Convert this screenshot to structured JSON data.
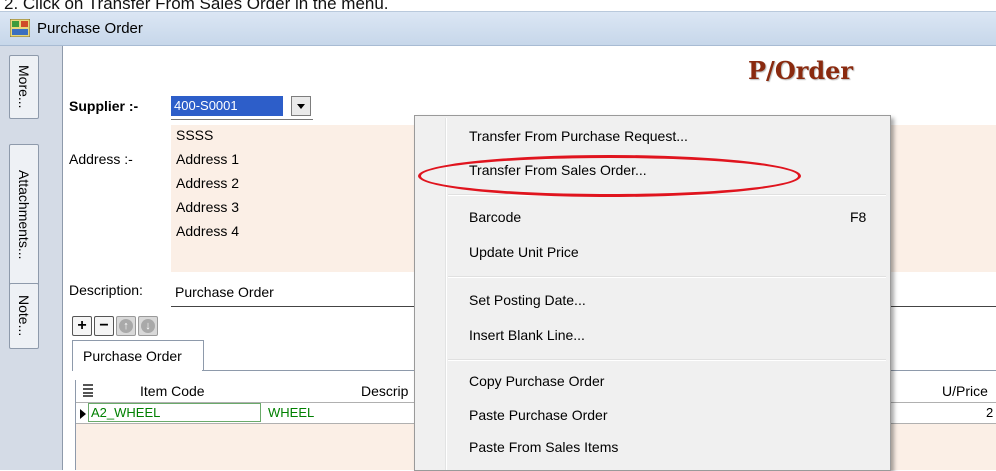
{
  "instruction": "2.   Click on Transfer From Sales Order in the menu.",
  "window": {
    "title": "Purchase Order"
  },
  "sidebar": {
    "tabs": [
      "More...",
      "Attachments...",
      "Note..."
    ]
  },
  "form": {
    "title": "P/Order",
    "supplier_label": "Supplier :-",
    "supplier_value": "400-S0001",
    "supplier_name": "SSSS",
    "address_label": "Address :-",
    "address_lines": [
      "Address 1",
      "Address 2",
      "Address 3",
      "Address 4"
    ],
    "description_label": "Description:",
    "description_value": "Purchase Order",
    "toolbar": {
      "add": "+",
      "remove": "−",
      "up": "↑",
      "down": "↓"
    },
    "tab_label": "Purchase Order",
    "grid": {
      "headers": [
        "Item Code",
        "Descrip",
        "U/Price"
      ],
      "rows": [
        {
          "item_code": "A2_WHEEL",
          "description": "WHEEL",
          "uprice": "2"
        }
      ]
    }
  },
  "context_menu": {
    "items": [
      "Transfer From Purchase Request...",
      "Transfer From Sales Order...",
      "Barcode",
      "Update Unit Price",
      "Set Posting Date...",
      "Insert Blank Line...",
      "Copy Purchase Order",
      "Paste Purchase Order",
      "Paste From Sales Items"
    ],
    "barcode_shortcut": "F8"
  },
  "annotation": {
    "color": "#e0141e",
    "target": "Transfer From Sales Order..."
  }
}
